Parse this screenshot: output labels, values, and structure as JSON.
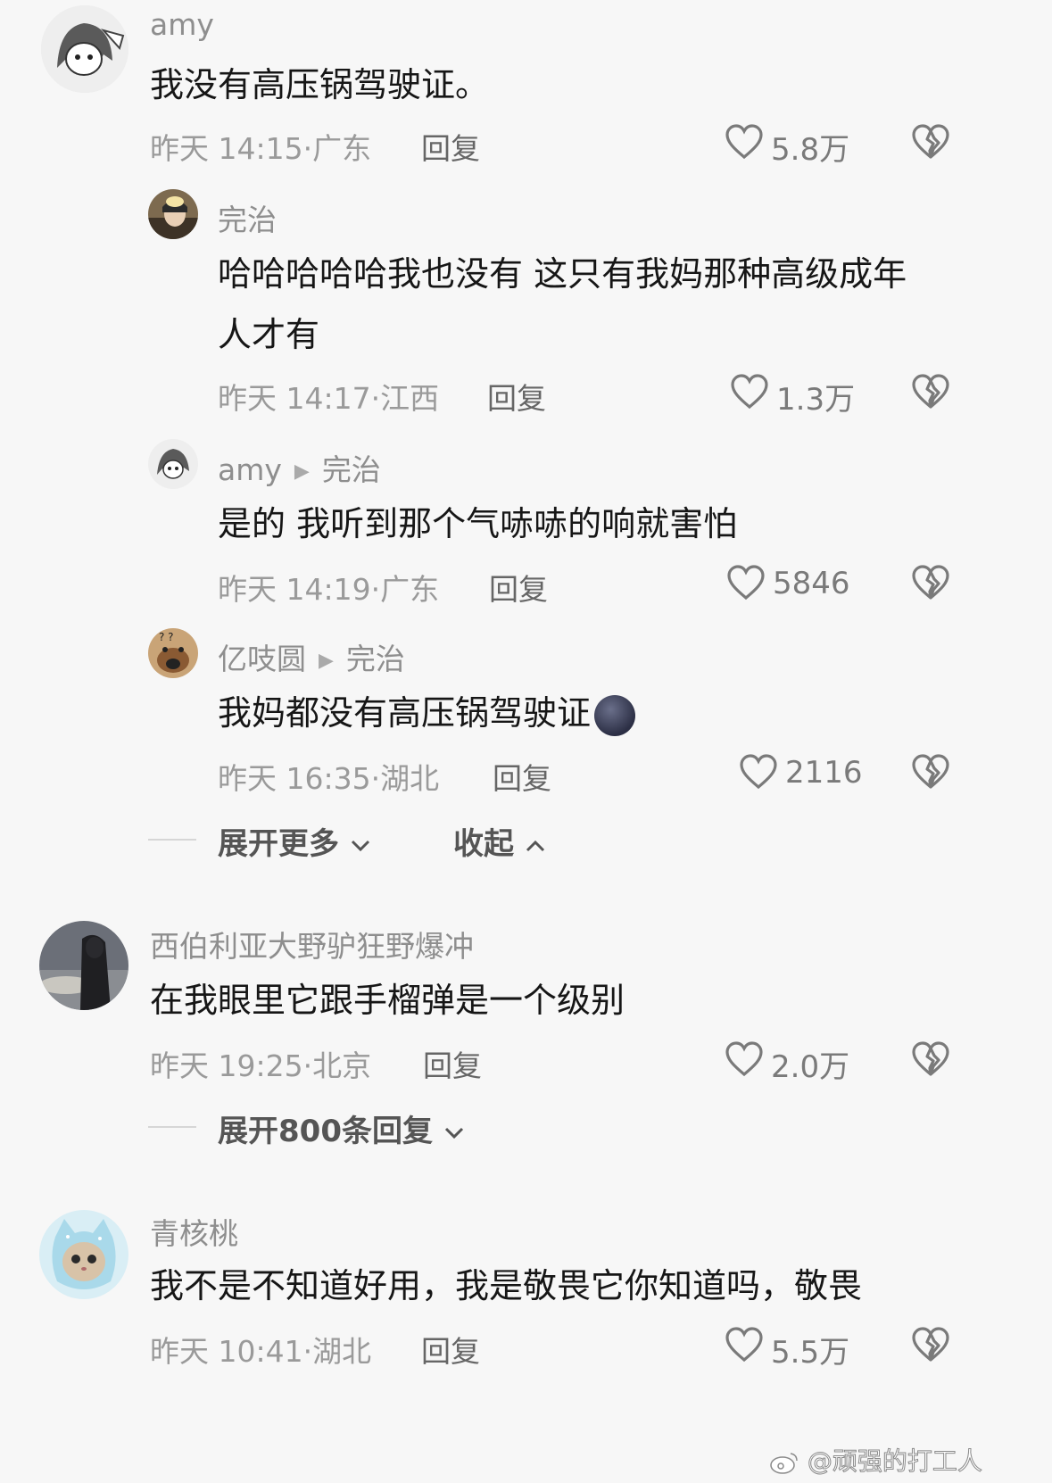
{
  "comments": [
    {
      "username": "amy",
      "text": "我没有高压锅驾驶证。",
      "time": "昨天 14:15",
      "location": "广东",
      "reply_label": "回复",
      "likes": "5.8万",
      "replies": [
        {
          "username": "完治",
          "text_line1": "哈哈哈哈哈我也没有 这只有我妈那种高级成年",
          "text_line2": "人才有",
          "time": "昨天 14:17",
          "location": "江西",
          "reply_label": "回复",
          "likes": "1.3万"
        },
        {
          "username": "amy",
          "reply_to": "完治",
          "text": "是的 我听到那个气哧哧的响就害怕",
          "time": "昨天 14:19",
          "location": "广东",
          "reply_label": "回复",
          "likes": "5846"
        },
        {
          "username": "亿吱圆",
          "reply_to": "完治",
          "text": "我妈都没有高压锅驾驶证",
          "time": "昨天 16:35",
          "location": "湖北",
          "reply_label": "回复",
          "likes": "2116"
        }
      ],
      "expand_more": "展开更多",
      "collapse": "收起"
    },
    {
      "username": "西伯利亚大野驴狂野爆冲",
      "text": "在我眼里它跟手榴弹是一个级别",
      "time": "昨天 19:25",
      "location": "北京",
      "reply_label": "回复",
      "likes": "2.0万",
      "expand_replies": "展开800条回复"
    },
    {
      "username": "青核桃",
      "text": "我不是不知道好用，我是敬畏它你知道吗，敬畏",
      "time": "昨天 10:41",
      "location": "湖北",
      "reply_label": "回复",
      "likes": "5.5万"
    }
  ],
  "watermark": "@顽强的打工人",
  "icons": {
    "like": "heart-outline-icon",
    "dislike": "broken-heart-icon",
    "reply_arrow": "triangle-right-icon",
    "chevron_down": "chevron-down-icon",
    "chevron_up": "chevron-up-icon"
  }
}
